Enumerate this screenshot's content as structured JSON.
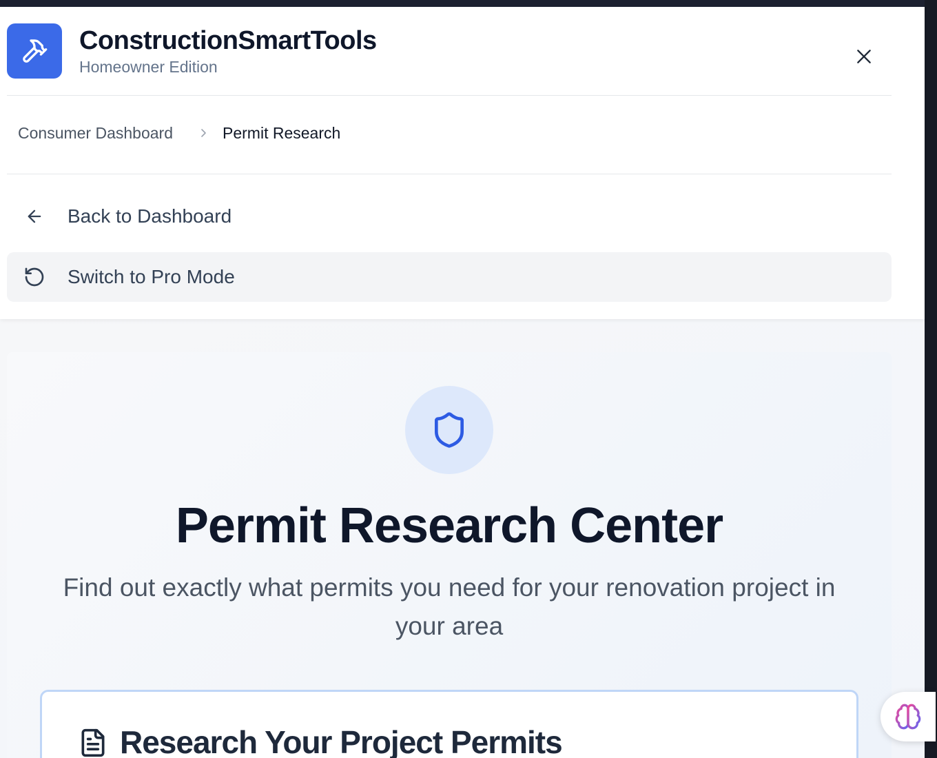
{
  "header": {
    "app_title": "ConstructionSmartTools",
    "app_subtitle": "Homeowner Edition",
    "logo_icon": "hammer-icon",
    "close_icon": "close-icon",
    "accent_color": "#3b6ae8"
  },
  "breadcrumb": {
    "items": [
      "Consumer Dashboard",
      "Permit Research"
    ],
    "separator_icon": "chevron-right-icon"
  },
  "nav": {
    "back_label": "Back to Dashboard",
    "back_icon": "arrow-left-icon",
    "pro_label": "Switch to Pro Mode",
    "pro_icon": "rotate-ccw-icon"
  },
  "hero": {
    "icon": "shield-icon",
    "title": "Permit Research Center",
    "subtitle": "Find out exactly what permits you need for your renovation project in your area"
  },
  "card": {
    "icon": "document-icon",
    "title": "Research Your Project Permits"
  },
  "fab": {
    "icon": "brain-icon"
  }
}
